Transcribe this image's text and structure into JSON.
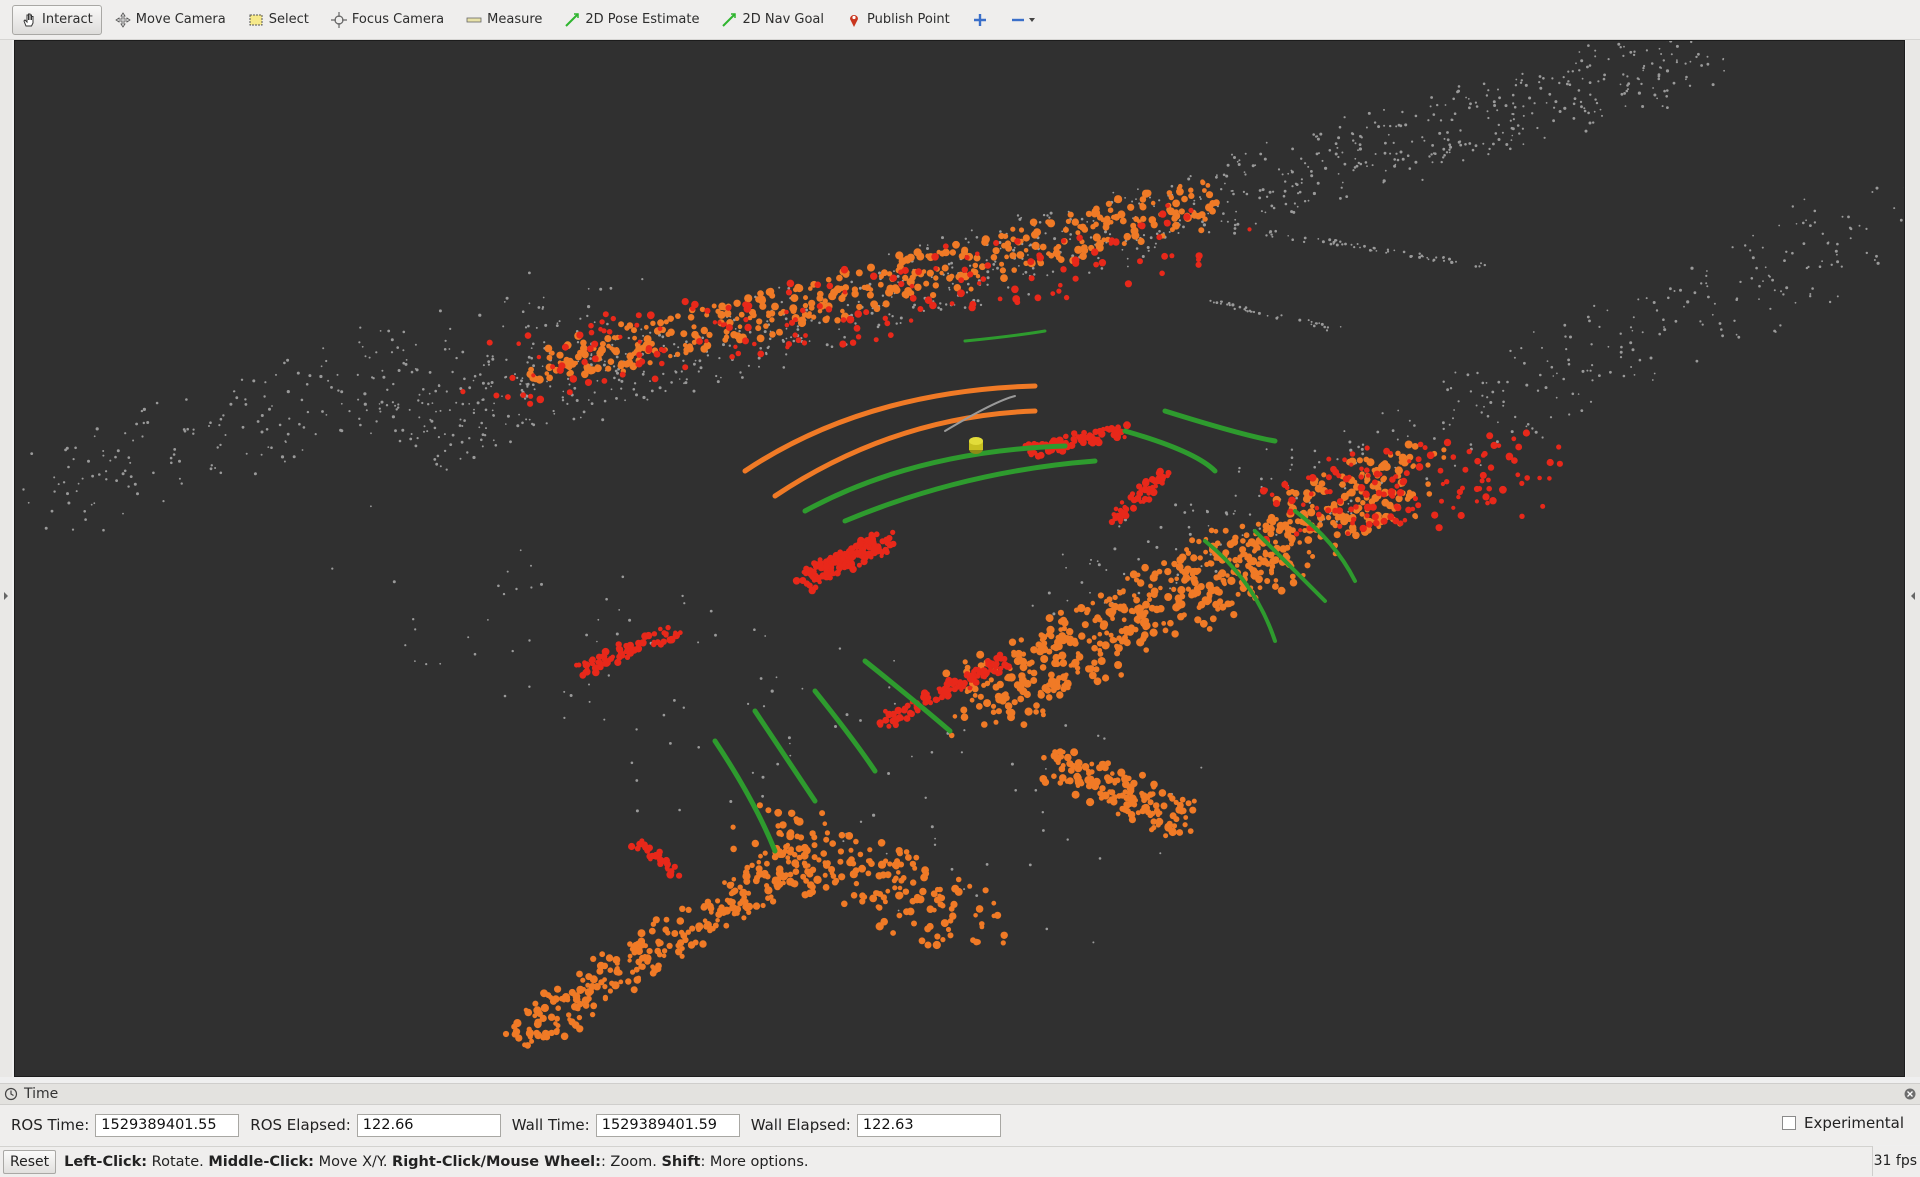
{
  "toolbar": {
    "items": [
      {
        "label": "Interact",
        "icon": "hand-icon",
        "active": true
      },
      {
        "label": "Move Camera",
        "icon": "move-camera-icon"
      },
      {
        "label": "Select",
        "icon": "select-icon"
      },
      {
        "label": "Focus Camera",
        "icon": "focus-camera-icon"
      },
      {
        "label": "Measure",
        "icon": "measure-icon"
      },
      {
        "label": "2D Pose Estimate",
        "icon": "pose-estimate-icon"
      },
      {
        "label": "2D Nav Goal",
        "icon": "nav-goal-icon"
      },
      {
        "label": "Publish Point",
        "icon": "publish-point-icon"
      }
    ]
  },
  "time_panel": {
    "title": "Time",
    "ros_time_label": "ROS Time:",
    "ros_time": "1529389401.55",
    "ros_elapsed_label": "ROS Elapsed:",
    "ros_elapsed": "122.66",
    "wall_time_label": "Wall Time:",
    "wall_time": "1529389401.59",
    "wall_elapsed_label": "Wall Elapsed:",
    "wall_elapsed": "122.63",
    "experimental_label": "Experimental"
  },
  "status_bar": {
    "reset_label": "Reset",
    "left_click": "Left-Click:",
    "left_click_desc": " Rotate. ",
    "middle_click": "Middle-Click:",
    "middle_click_desc": " Move X/Y. ",
    "right_click": "Right-Click/Mouse Wheel:",
    "right_click_desc": ": Zoom. ",
    "shift": "Shift",
    "shift_desc": ": More options.",
    "fps": "31 fps"
  },
  "colors": {
    "viewport_bg": "#303030",
    "point_red": "#e8281a",
    "point_orange": "#f07a26",
    "point_green": "#2e9b2e",
    "point_gray": "#9a9a9a",
    "robot_marker": "#c8c020"
  }
}
